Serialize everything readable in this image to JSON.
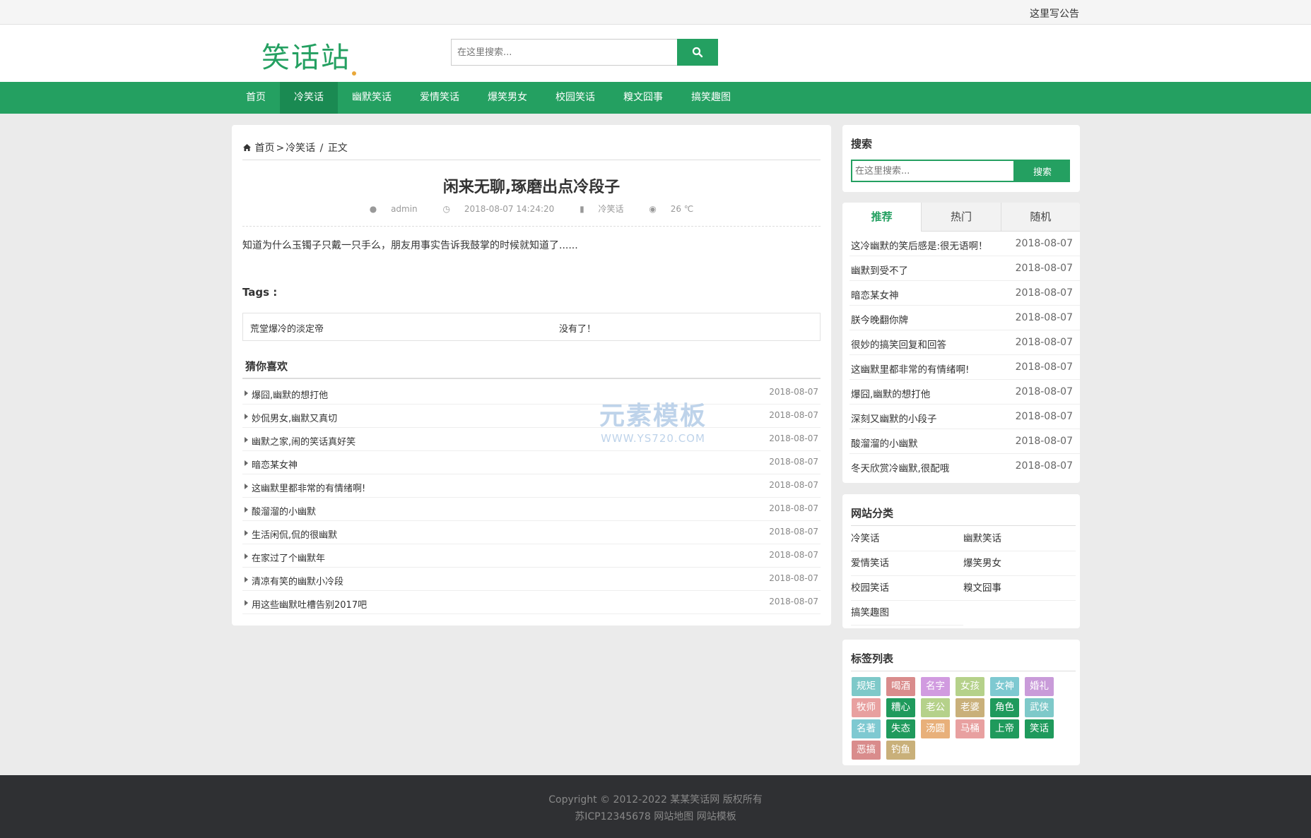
{
  "topbar": {
    "notice": "这里写公告"
  },
  "header": {
    "logo": "笑话站",
    "search_placeholder": "在这里搜索..."
  },
  "nav": [
    {
      "label": "首页",
      "active": false
    },
    {
      "label": "冷笑话",
      "active": true
    },
    {
      "label": "幽默笑话",
      "active": false
    },
    {
      "label": "爱情笑话",
      "active": false
    },
    {
      "label": "爆笑男女",
      "active": false
    },
    {
      "label": "校园笑话",
      "active": false
    },
    {
      "label": "糗文囧事",
      "active": false
    },
    {
      "label": "搞笑趣图",
      "active": false
    }
  ],
  "breadcrumb": {
    "home": "首页",
    "category": "冷笑话",
    "current": "正文"
  },
  "article": {
    "title": "闲来无聊,琢磨出点冷段子",
    "author": "admin",
    "datetime": "2018-08-07 14:24:20",
    "category": "冷笑话",
    "views": "26 ℃",
    "content": "知道为什么玉镯子只戴一只手么，朋友用事实告诉我鼓掌的时候就知道了......",
    "tags_label": "Tags :",
    "prev": "荒堂爆冷的淡定帝",
    "next": "没有了！"
  },
  "guess": {
    "title": "猜你喜欢",
    "items": [
      {
        "title": "爆囧,幽默的想打他",
        "date": "2018-08-07"
      },
      {
        "title": "妙侃男女,幽默又真切",
        "date": "2018-08-07"
      },
      {
        "title": "幽默之家,闹的笑话真好笑",
        "date": "2018-08-07"
      },
      {
        "title": "暗恋某女神",
        "date": "2018-08-07"
      },
      {
        "title": "这幽默里都非常的有情绪啊!",
        "date": "2018-08-07"
      },
      {
        "title": "酸溜溜的小幽默",
        "date": "2018-08-07"
      },
      {
        "title": "生活闲侃,侃的很幽默",
        "date": "2018-08-07"
      },
      {
        "title": "在家过了个幽默年",
        "date": "2018-08-07"
      },
      {
        "title": "清凉有笑的幽默小冷段",
        "date": "2018-08-07"
      },
      {
        "title": "用这些幽默吐槽告别2017吧",
        "date": "2018-08-07"
      }
    ]
  },
  "watermark": {
    "big": "元素模板",
    "small": "WWW.YS720.COM"
  },
  "sidebar": {
    "search": {
      "title": "搜索",
      "placeholder": "在这里搜索...",
      "button": "搜索"
    },
    "tabs": [
      "推荐",
      "热门",
      "随机"
    ],
    "recommend": [
      {
        "title": "这冷幽默的笑后感是:很无语啊！",
        "date": "2018-08-07"
      },
      {
        "title": "幽默到受不了",
        "date": "2018-08-07"
      },
      {
        "title": "暗恋某女神",
        "date": "2018-08-07"
      },
      {
        "title": "朕今晚翻你牌",
        "date": "2018-08-07"
      },
      {
        "title": "很妙的搞笑回复和回答",
        "date": "2018-08-07"
      },
      {
        "title": "这幽默里都非常的有情绪啊!",
        "date": "2018-08-07"
      },
      {
        "title": "爆囧,幽默的想打他",
        "date": "2018-08-07"
      },
      {
        "title": "深刻又幽默的小段子",
        "date": "2018-08-07"
      },
      {
        "title": "酸溜溜的小幽默",
        "date": "2018-08-07"
      },
      {
        "title": "冬天欣赏冷幽默,很配哦",
        "date": "2018-08-07"
      }
    ],
    "categories_title": "网站分类",
    "categories": [
      "冷笑话",
      "幽默笑话",
      "爱情笑话",
      "爆笑男女",
      "校园笑话",
      "糗文囧事",
      "搞笑趣图"
    ],
    "tags_title": "标签列表",
    "tags": [
      {
        "label": "规矩",
        "color": "#7ec9c9"
      },
      {
        "label": "喝酒",
        "color": "#d98c8c"
      },
      {
        "label": "名字",
        "color": "#d19be0"
      },
      {
        "label": "女孩",
        "color": "#b5d18a"
      },
      {
        "label": "女神",
        "color": "#7ec9d1"
      },
      {
        "label": "婚礼",
        "color": "#c99bd9"
      },
      {
        "label": "牧师",
        "color": "#e8a0a0"
      },
      {
        "label": "糟心",
        "color": "#1f9a5c"
      },
      {
        "label": "老公",
        "color": "#b5d18a"
      },
      {
        "label": "老婆",
        "color": "#c9b07a"
      },
      {
        "label": "角色",
        "color": "#1f9a5c"
      },
      {
        "label": "武侠",
        "color": "#7ec9c9"
      },
      {
        "label": "名著",
        "color": "#7ec9d1"
      },
      {
        "label": "失态",
        "color": "#1f9a5c"
      },
      {
        "label": "汤圆",
        "color": "#e8b07a"
      },
      {
        "label": "马桶",
        "color": "#e8a0a0"
      },
      {
        "label": "上帝",
        "color": "#1f9a5c"
      },
      {
        "label": "笑话",
        "color": "#1f9a5c"
      },
      {
        "label": "恶搞",
        "color": "#d98c8c"
      },
      {
        "label": "钓鱼",
        "color": "#c9b07a"
      }
    ]
  },
  "footer": {
    "line1": "Copyright © 2012-2022 某某笑话网 版权所有",
    "line2": "苏ICP12345678 网站地图 网站模板"
  },
  "colors": {
    "brand": "#24a061",
    "nav_active": "#1a8a52",
    "footer": "#2f3033"
  }
}
